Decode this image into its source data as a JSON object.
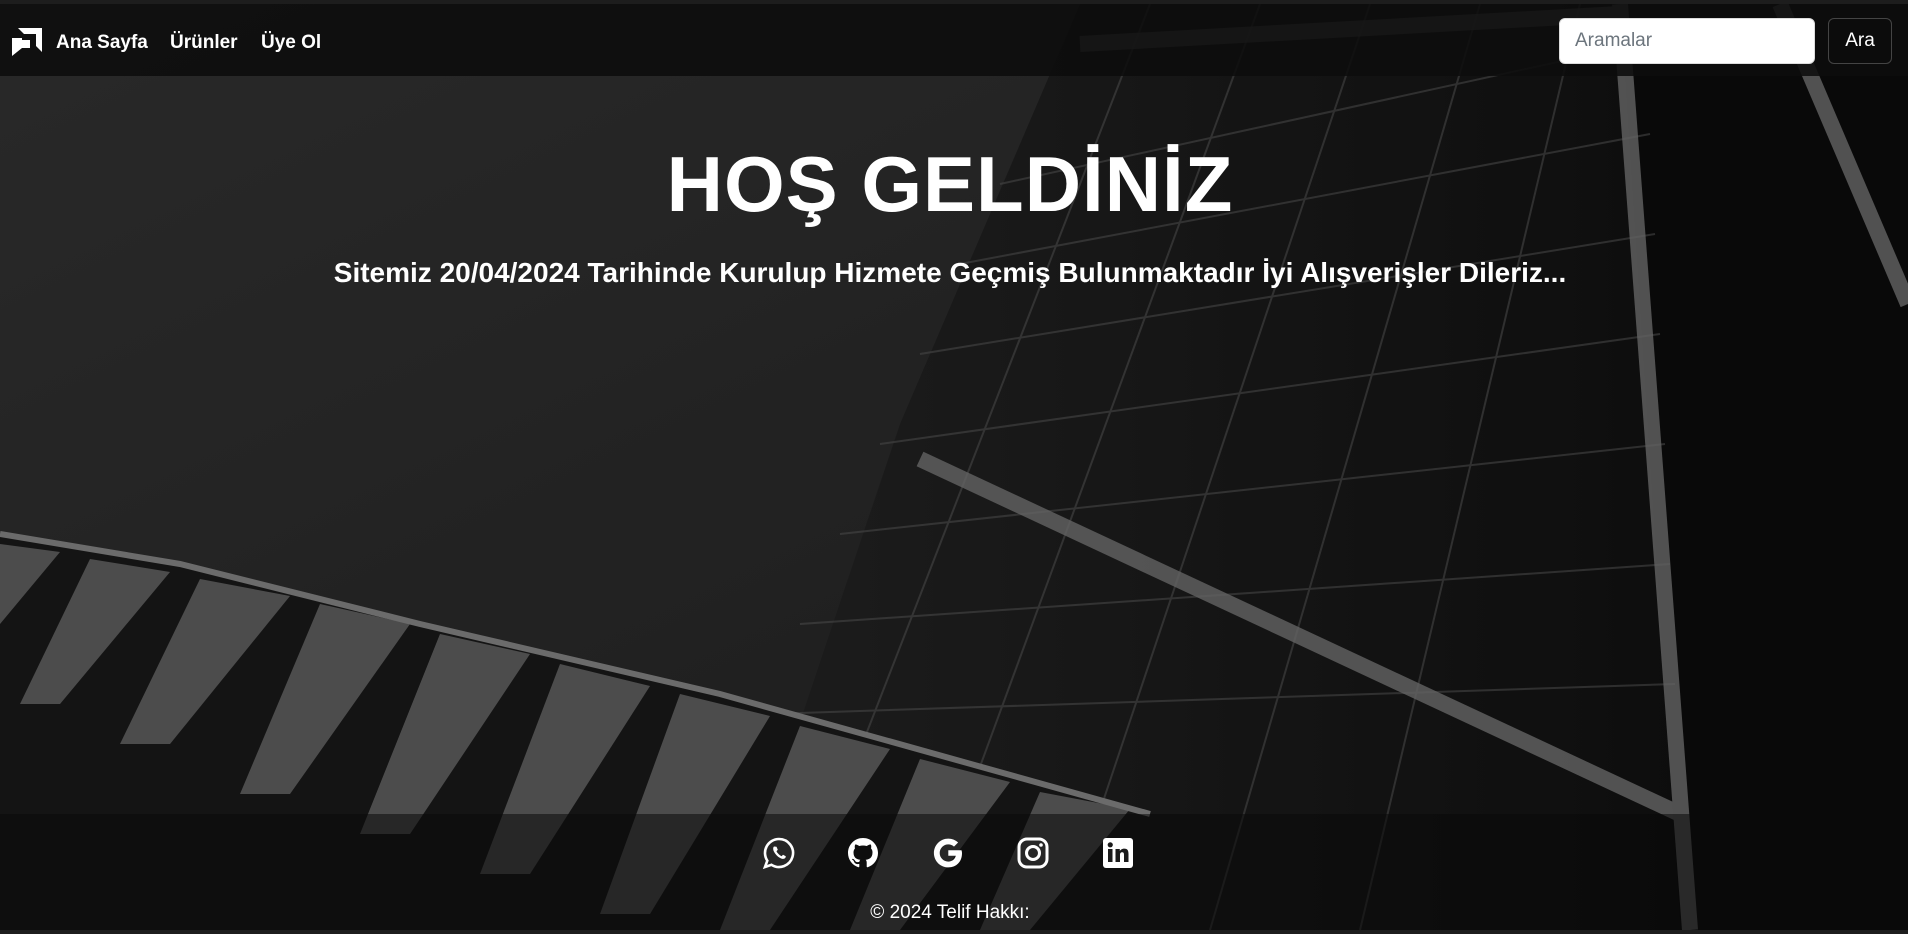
{
  "nav": {
    "brand_icon": "amd-logo-icon",
    "links": [
      "Ana Sayfa",
      "Ürünler",
      "Üye Ol"
    ]
  },
  "search": {
    "placeholder": "Aramalar",
    "value": "",
    "button_label": "Ara"
  },
  "hero": {
    "title": "HOŞ GELDİNİZ",
    "subtitle": "Sitemiz 20/04/2024 Tarihinde Kurulup Hizmete Geçmiş Bulunmaktadır İyi Alışverişler Dileriz..."
  },
  "footer": {
    "social_icons": [
      "whatsapp-icon",
      "github-icon",
      "google-icon",
      "instagram-icon",
      "linkedin-icon"
    ],
    "copyright": "© 2024 Telif Hakkı:"
  },
  "colors": {
    "navbar_bg": "#0c0c0c",
    "text": "#ffffff",
    "search_bg": "#ffffff"
  }
}
